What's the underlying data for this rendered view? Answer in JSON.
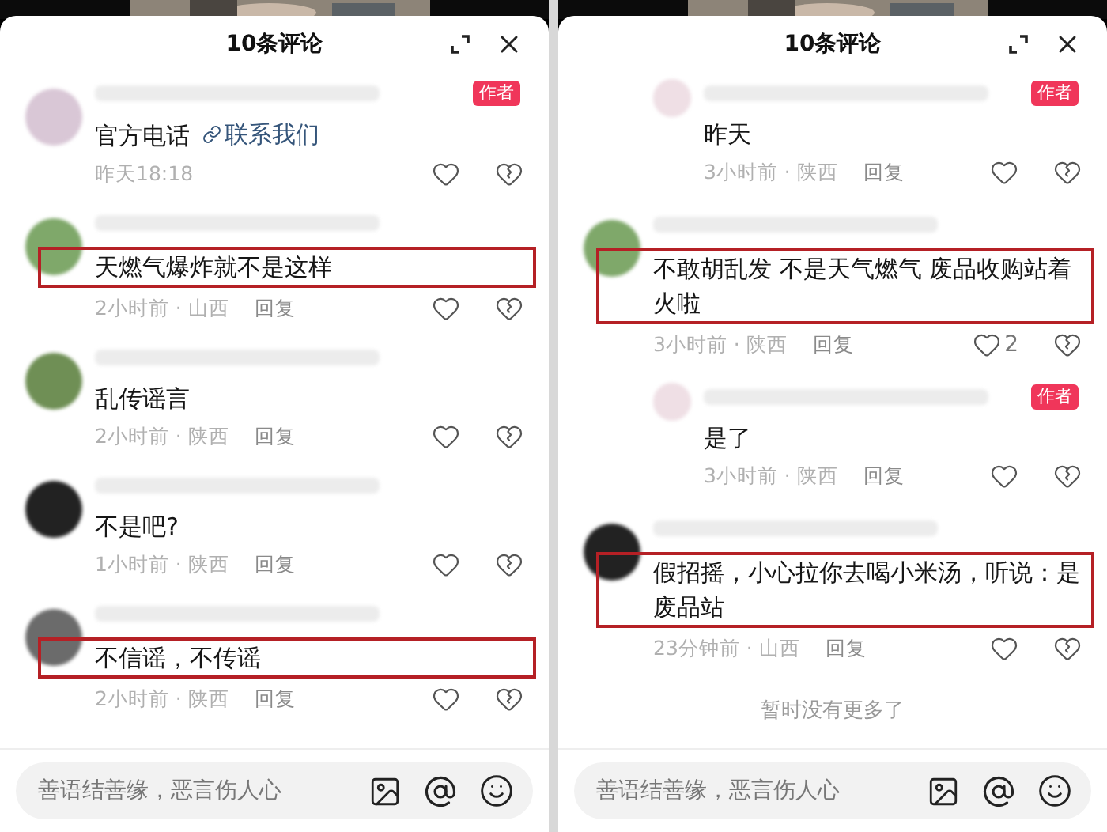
{
  "panels": [
    {
      "title": "10条评论",
      "comments": [
        {
          "kind": "comment",
          "author_badge": "作者",
          "text": "官方电话",
          "link": "联系我们",
          "meta": "昨天18:18",
          "highlighted": false
        },
        {
          "kind": "comment",
          "text": "天燃气爆炸就不是这样",
          "meta": "2小时前 · 山西",
          "reply": "回复",
          "highlighted": true
        },
        {
          "kind": "comment",
          "text": "乱传谣言",
          "meta": "2小时前 · 陕西",
          "reply": "回复",
          "highlighted": false
        },
        {
          "kind": "comment",
          "text": "不是吧?",
          "meta": "1小时前 · 陕西",
          "reply": "回复",
          "highlighted": false
        },
        {
          "kind": "comment",
          "text": "不信谣，不传谣",
          "meta": "2小时前 · 陕西",
          "reply": "回复",
          "highlighted": true
        }
      ],
      "input": {
        "placeholder": "善语结善缘，恶言伤人心"
      }
    },
    {
      "title": "10条评论",
      "comments": [
        {
          "kind": "reply",
          "author_badge": "作者",
          "text": "昨天",
          "meta": "3小时前 · 陕西",
          "reply": "回复",
          "highlighted": false
        },
        {
          "kind": "comment",
          "text": "不敢胡乱发  不是天气燃气  废品收购站着火啦",
          "meta": "3小时前 · 陕西",
          "reply": "回复",
          "likes": "2",
          "highlighted": true
        },
        {
          "kind": "reply",
          "author_badge": "作者",
          "text": "是了",
          "meta": "3小时前 · 陕西",
          "reply": "回复",
          "highlighted": false
        },
        {
          "kind": "comment",
          "text": "假招摇，小心拉你去喝小米汤，听说：是废品站",
          "meta": "23分钟前 · 山西",
          "reply": "回复",
          "highlighted": true
        }
      ],
      "end_note": "暂时没有更多了",
      "input": {
        "placeholder": "善语结善缘，恶言伤人心"
      }
    }
  ]
}
